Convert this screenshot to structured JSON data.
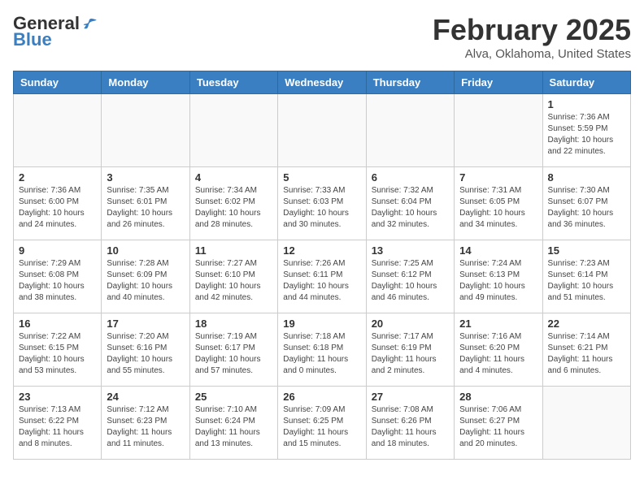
{
  "header": {
    "logo_general": "General",
    "logo_blue": "Blue",
    "month_title": "February 2025",
    "location": "Alva, Oklahoma, United States"
  },
  "weekdays": [
    "Sunday",
    "Monday",
    "Tuesday",
    "Wednesday",
    "Thursday",
    "Friday",
    "Saturday"
  ],
  "weeks": [
    [
      {
        "day": "",
        "info": ""
      },
      {
        "day": "",
        "info": ""
      },
      {
        "day": "",
        "info": ""
      },
      {
        "day": "",
        "info": ""
      },
      {
        "day": "",
        "info": ""
      },
      {
        "day": "",
        "info": ""
      },
      {
        "day": "1",
        "info": "Sunrise: 7:36 AM\nSunset: 5:59 PM\nDaylight: 10 hours\nand 22 minutes."
      }
    ],
    [
      {
        "day": "2",
        "info": "Sunrise: 7:36 AM\nSunset: 6:00 PM\nDaylight: 10 hours\nand 24 minutes."
      },
      {
        "day": "3",
        "info": "Sunrise: 7:35 AM\nSunset: 6:01 PM\nDaylight: 10 hours\nand 26 minutes."
      },
      {
        "day": "4",
        "info": "Sunrise: 7:34 AM\nSunset: 6:02 PM\nDaylight: 10 hours\nand 28 minutes."
      },
      {
        "day": "5",
        "info": "Sunrise: 7:33 AM\nSunset: 6:03 PM\nDaylight: 10 hours\nand 30 minutes."
      },
      {
        "day": "6",
        "info": "Sunrise: 7:32 AM\nSunset: 6:04 PM\nDaylight: 10 hours\nand 32 minutes."
      },
      {
        "day": "7",
        "info": "Sunrise: 7:31 AM\nSunset: 6:05 PM\nDaylight: 10 hours\nand 34 minutes."
      },
      {
        "day": "8",
        "info": "Sunrise: 7:30 AM\nSunset: 6:07 PM\nDaylight: 10 hours\nand 36 minutes."
      }
    ],
    [
      {
        "day": "9",
        "info": "Sunrise: 7:29 AM\nSunset: 6:08 PM\nDaylight: 10 hours\nand 38 minutes."
      },
      {
        "day": "10",
        "info": "Sunrise: 7:28 AM\nSunset: 6:09 PM\nDaylight: 10 hours\nand 40 minutes."
      },
      {
        "day": "11",
        "info": "Sunrise: 7:27 AM\nSunset: 6:10 PM\nDaylight: 10 hours\nand 42 minutes."
      },
      {
        "day": "12",
        "info": "Sunrise: 7:26 AM\nSunset: 6:11 PM\nDaylight: 10 hours\nand 44 minutes."
      },
      {
        "day": "13",
        "info": "Sunrise: 7:25 AM\nSunset: 6:12 PM\nDaylight: 10 hours\nand 46 minutes."
      },
      {
        "day": "14",
        "info": "Sunrise: 7:24 AM\nSunset: 6:13 PM\nDaylight: 10 hours\nand 49 minutes."
      },
      {
        "day": "15",
        "info": "Sunrise: 7:23 AM\nSunset: 6:14 PM\nDaylight: 10 hours\nand 51 minutes."
      }
    ],
    [
      {
        "day": "16",
        "info": "Sunrise: 7:22 AM\nSunset: 6:15 PM\nDaylight: 10 hours\nand 53 minutes."
      },
      {
        "day": "17",
        "info": "Sunrise: 7:20 AM\nSunset: 6:16 PM\nDaylight: 10 hours\nand 55 minutes."
      },
      {
        "day": "18",
        "info": "Sunrise: 7:19 AM\nSunset: 6:17 PM\nDaylight: 10 hours\nand 57 minutes."
      },
      {
        "day": "19",
        "info": "Sunrise: 7:18 AM\nSunset: 6:18 PM\nDaylight: 11 hours\nand 0 minutes."
      },
      {
        "day": "20",
        "info": "Sunrise: 7:17 AM\nSunset: 6:19 PM\nDaylight: 11 hours\nand 2 minutes."
      },
      {
        "day": "21",
        "info": "Sunrise: 7:16 AM\nSunset: 6:20 PM\nDaylight: 11 hours\nand 4 minutes."
      },
      {
        "day": "22",
        "info": "Sunrise: 7:14 AM\nSunset: 6:21 PM\nDaylight: 11 hours\nand 6 minutes."
      }
    ],
    [
      {
        "day": "23",
        "info": "Sunrise: 7:13 AM\nSunset: 6:22 PM\nDaylight: 11 hours\nand 8 minutes."
      },
      {
        "day": "24",
        "info": "Sunrise: 7:12 AM\nSunset: 6:23 PM\nDaylight: 11 hours\nand 11 minutes."
      },
      {
        "day": "25",
        "info": "Sunrise: 7:10 AM\nSunset: 6:24 PM\nDaylight: 11 hours\nand 13 minutes."
      },
      {
        "day": "26",
        "info": "Sunrise: 7:09 AM\nSunset: 6:25 PM\nDaylight: 11 hours\nand 15 minutes."
      },
      {
        "day": "27",
        "info": "Sunrise: 7:08 AM\nSunset: 6:26 PM\nDaylight: 11 hours\nand 18 minutes."
      },
      {
        "day": "28",
        "info": "Sunrise: 7:06 AM\nSunset: 6:27 PM\nDaylight: 11 hours\nand 20 minutes."
      },
      {
        "day": "",
        "info": ""
      }
    ]
  ]
}
